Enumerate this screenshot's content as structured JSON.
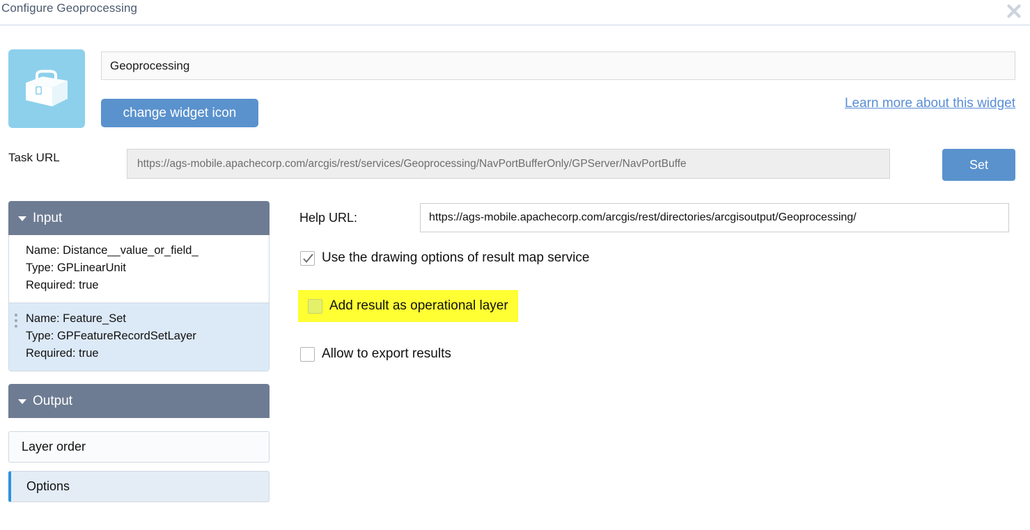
{
  "window": {
    "title": "Configure Geoprocessing",
    "close_icon": "close-icon"
  },
  "widget": {
    "icon_name": "toolbox-icon",
    "name_value": "Geoprocessing",
    "name_placeholder": "Widget name",
    "change_icon_label": "change widget icon",
    "learn_more_label": "Learn more about this widget"
  },
  "task_url": {
    "label": "Task URL",
    "value": "https://ags-mobile.apachecorp.com/arcgis/rest/services/Geoprocessing/NavPortBufferOnly/GPServer/NavPortBuffe",
    "placeholder": "Task URL",
    "set_label": "Set"
  },
  "left_panel": {
    "input": {
      "header": "Input",
      "caret_icon": "chevron-down-icon",
      "items": [
        {
          "name_line": "Name:  Distance__value_or_field_",
          "type_line": "Type:  GPLinearUnit",
          "required_line": "Required:  true",
          "selected": false
        },
        {
          "name_line": "Name:  Feature_Set",
          "type_line": "Type:  GPFeatureRecordSetLayer",
          "required_line": "Required:  true",
          "selected": true
        }
      ]
    },
    "output": {
      "header": "Output",
      "caret_icon": "chevron-down-icon",
      "items": [
        {
          "label": "Layer order",
          "selected": false
        },
        {
          "label": "Options",
          "selected": true
        }
      ]
    }
  },
  "options": {
    "help_url_label": "Help URL:",
    "help_url_value": "https://ags-mobile.apachecorp.com/arcgis/rest/directories/arcgisoutput/Geoprocessing/",
    "help_url_placeholder": "Help URL",
    "checkboxes": [
      {
        "label": "Use the drawing options of result map service",
        "checked": true,
        "highlighted": false
      },
      {
        "label": "Add result as operational layer",
        "checked": false,
        "highlighted": true
      },
      {
        "label": "Allow to export results",
        "checked": false,
        "highlighted": false
      }
    ]
  },
  "colors": {
    "accent_blue": "#5a92cd",
    "link_blue": "#5a8dd6",
    "panel_header": "#6e7c93",
    "selection_blue": "#dce9f7",
    "selected_border": "#2b93e0",
    "widget_icon_bg": "#8dd0ec",
    "highlight_yellow": "#ffff33",
    "title_text": "#4c5a6e"
  }
}
